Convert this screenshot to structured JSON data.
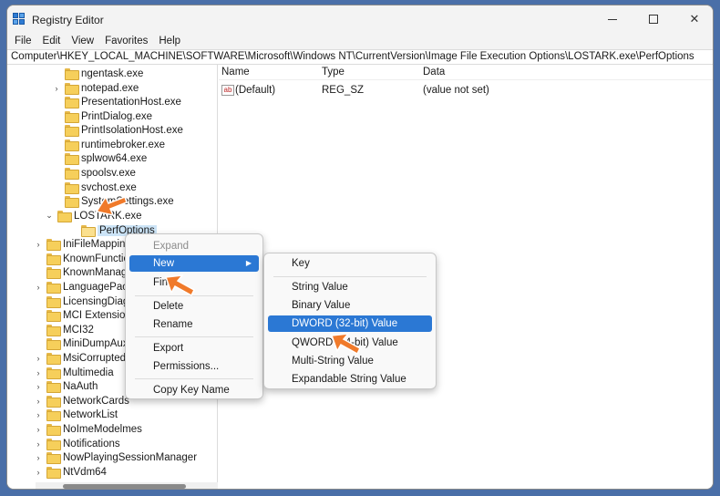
{
  "window": {
    "title": "Registry Editor"
  },
  "menu": [
    "File",
    "Edit",
    "View",
    "Favorites",
    "Help"
  ],
  "address": "Computer\\HKEY_LOCAL_MACHINE\\SOFTWARE\\Microsoft\\Windows NT\\CurrentVersion\\Image File Execution Options\\LOSTARK.exe\\PerfOptions",
  "tree": {
    "items": [
      {
        "label": "ngentask.exe",
        "chev": ""
      },
      {
        "label": "notepad.exe",
        "chev": "›"
      },
      {
        "label": "PresentationHost.exe",
        "chev": ""
      },
      {
        "label": "PrintDialog.exe",
        "chev": ""
      },
      {
        "label": "PrintIsolationHost.exe",
        "chev": ""
      },
      {
        "label": "runtimebroker.exe",
        "chev": ""
      },
      {
        "label": "splwow64.exe",
        "chev": ""
      },
      {
        "label": "spoolsv.exe",
        "chev": ""
      },
      {
        "label": "svchost.exe",
        "chev": ""
      },
      {
        "label": "SystemSettings.exe",
        "chev": ""
      },
      {
        "label": "LOSTARK.exe",
        "chev": "⌄"
      },
      {
        "label": "PerfOptions",
        "chev": ""
      },
      {
        "label": "IniFileMapping",
        "chev": "›"
      },
      {
        "label": "KnownFunctionTableDlls",
        "chev": ""
      },
      {
        "label": "KnownManagedDebuggingDlls",
        "chev": ""
      },
      {
        "label": "LanguagePack",
        "chev": "›"
      },
      {
        "label": "LicensingDiag",
        "chev": ""
      },
      {
        "label": "MCI Extensions",
        "chev": ""
      },
      {
        "label": "MCI32",
        "chev": ""
      },
      {
        "label": "MiniDumpAuxiliaryDlls",
        "chev": ""
      },
      {
        "label": "MsiCorruptedFileRecovery",
        "chev": "›"
      },
      {
        "label": "Multimedia",
        "chev": "›"
      },
      {
        "label": "NaAuth",
        "chev": "›"
      },
      {
        "label": "NetworkCards",
        "chev": "›"
      },
      {
        "label": "NetworkList",
        "chev": "›"
      },
      {
        "label": "NoImeModelmes",
        "chev": "›"
      },
      {
        "label": "Notifications",
        "chev": "›"
      },
      {
        "label": "NowPlayingSessionManager",
        "chev": "›"
      },
      {
        "label": "NtVdm64",
        "chev": "›"
      }
    ]
  },
  "values": {
    "headers": {
      "name": "Name",
      "type": "Type",
      "data": "Data"
    },
    "rows": [
      {
        "icon": "ab",
        "name": "(Default)",
        "type": "REG_SZ",
        "data": "(value not set)"
      }
    ]
  },
  "context_menu": {
    "items": {
      "expand": "Expand",
      "new": "New",
      "find": "Find...",
      "delete": "Delete",
      "rename": "Rename",
      "export": "Export",
      "permissions": "Permissions...",
      "copy_key_name": "Copy Key Name"
    }
  },
  "submenu": {
    "items": {
      "key": "Key",
      "string_value": "String Value",
      "binary_value": "Binary Value",
      "dword_value": "DWORD (32-bit) Value",
      "qword_value": "QWORD (64-bit) Value",
      "multi_string_value": "Multi-String Value",
      "expandable_string_value": "Expandable String Value"
    }
  },
  "colors": {
    "highlight": "#2b78d4",
    "selection": "#cce4f7",
    "pointer": "#f07a2a"
  }
}
